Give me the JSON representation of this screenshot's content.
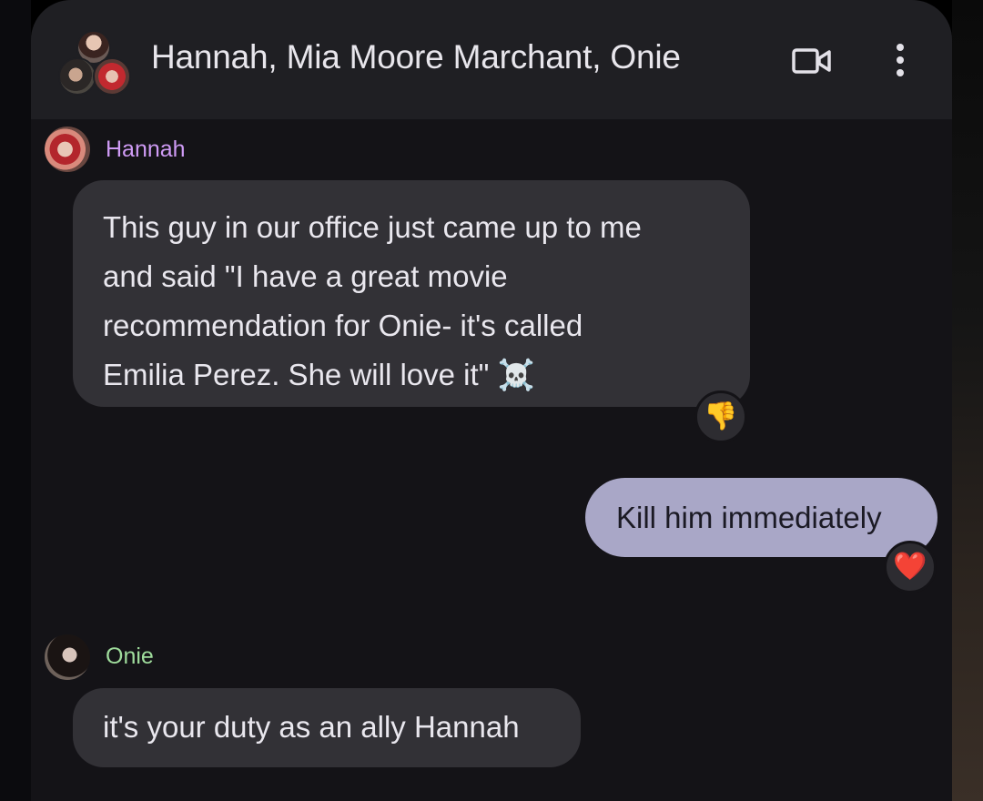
{
  "header": {
    "title": "Hannah, Mia Moore Marchant, Onie",
    "icons": [
      "video-call-icon",
      "more-vert-icon"
    ]
  },
  "messages": [
    {
      "sender": "Hannah",
      "lines": [
        "This guy in our office just came up to me",
        "and said \"I have a great movie",
        "recommendation for Onie- it's called",
        "Emilia Perez. She will love it\" ☠️"
      ],
      "reaction": "👎"
    },
    {
      "sender": "self",
      "text": "Kill him immediately",
      "reaction": "❤️"
    },
    {
      "sender": "Onie",
      "text": "it's your duty as an ally Hannah"
    }
  ],
  "colors": {
    "background": "#141317",
    "header": "#1f1f23",
    "incoming_bubble": "#323136",
    "outgoing_bubble": "#a9a7c7",
    "hannah_name": "#cf9bf5",
    "onie_name": "#9fdc9c"
  }
}
